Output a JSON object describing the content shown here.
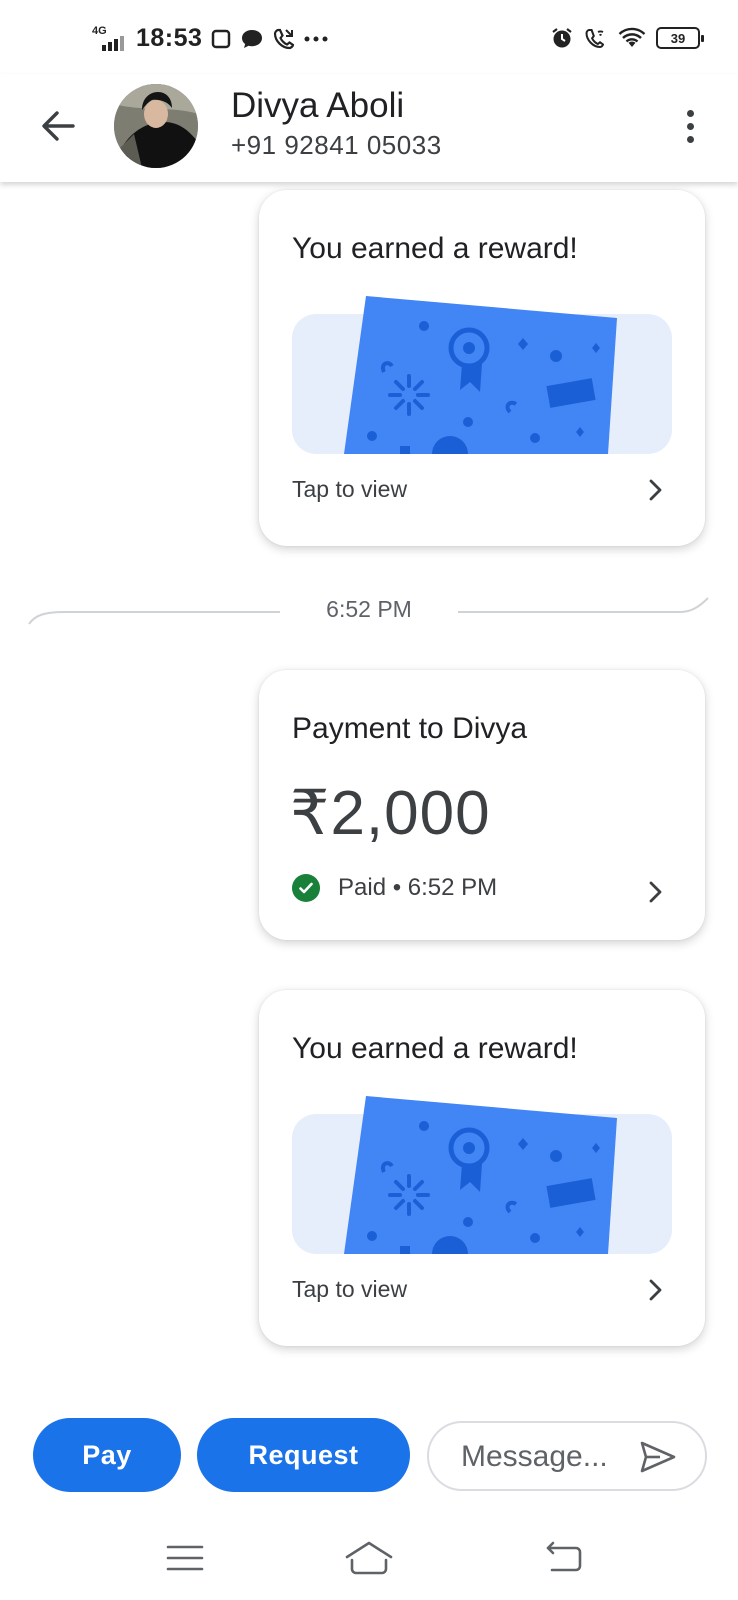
{
  "status_bar": {
    "network": "4G",
    "time": "18:53",
    "battery": "39",
    "left_icons": [
      "screenshot-icon",
      "chat-bubble-icon",
      "missed-call-icon",
      "more-notifications-icon"
    ],
    "right_icons": [
      "alarm-icon",
      "wifi-calling-icon",
      "wifi-icon",
      "battery-icon"
    ]
  },
  "header": {
    "contact_name": "Divya Aboli",
    "contact_phone": "+91 92841 05033",
    "back_icon": "arrow-left-icon",
    "menu_icon": "more-vert-icon"
  },
  "messages": {
    "reward_1": {
      "title": "You earned a reward!",
      "action": "Tap to view"
    },
    "time_divider": "6:52 PM",
    "payment": {
      "title": "Payment to Divya",
      "amount": "₹2,000",
      "status": "Paid • 6:52 PM",
      "status_color": "#188038"
    },
    "reward_2": {
      "title": "You earned a reward!",
      "action": "Tap to view"
    }
  },
  "composer": {
    "pay_label": "Pay",
    "request_label": "Request",
    "message_placeholder": "Message...",
    "accent_color": "#1a73e8"
  },
  "nav_bar": {
    "icons": [
      "menu-icon",
      "home-icon",
      "back-icon"
    ]
  }
}
